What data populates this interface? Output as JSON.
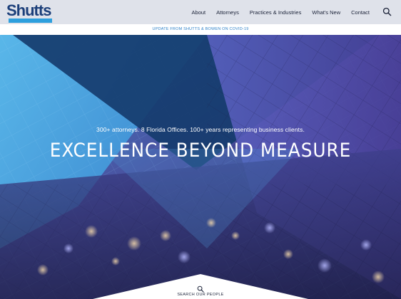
{
  "brand": {
    "logo_text": "Shutts",
    "navy": "#1c3f7a",
    "accent": "#2d9fdd"
  },
  "nav": {
    "items": [
      "About",
      "Attorneys",
      "Practices & Industries",
      "What's New",
      "Contact"
    ],
    "search_icon": "search-icon"
  },
  "alert": {
    "text": "UPDATE FROM SHUTTS & BOWEN ON COVID-19"
  },
  "hero": {
    "tagline": "300+ attorneys. 8 Florida Offices. 100+ years representing business clients.",
    "headline": "EXCELLENCE BEYOND MEASURE"
  },
  "search_people": {
    "label": "SEARCH OUR PEOPLE",
    "icon": "search-icon"
  }
}
